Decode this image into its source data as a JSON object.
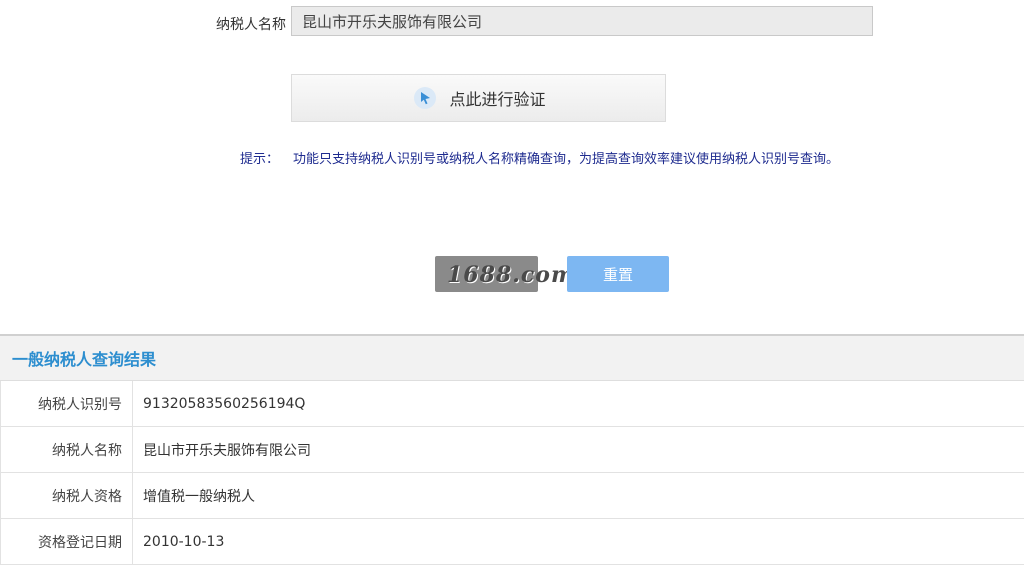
{
  "form": {
    "taxpayer_name_label": "纳税人名称",
    "taxpayer_name_value": "昆山市开乐夫服饰有限公司",
    "verify_label": "点此进行验证",
    "tip_label": "提示：",
    "tip_text": "功能只支持纳税人识别号或纳税人名称精确查询，为提高查询效率建议使用纳税人识别号查询。",
    "reset_label": "重置",
    "watermark_text": "1688.com"
  },
  "result": {
    "title": "一般纳税人查询结果",
    "rows": [
      {
        "key": "纳税人识别号",
        "value": "91320583560256194Q"
      },
      {
        "key": "纳税人名称",
        "value": "昆山市开乐夫服饰有限公司"
      },
      {
        "key": "纳税人资格",
        "value": "增值税一般纳税人"
      },
      {
        "key": "资格登记日期",
        "value": "2010-10-13"
      }
    ]
  },
  "colors": {
    "accent_blue": "#2d8ecf",
    "tip_color": "#1e2b8f",
    "reset_button": "#7db7f2"
  }
}
